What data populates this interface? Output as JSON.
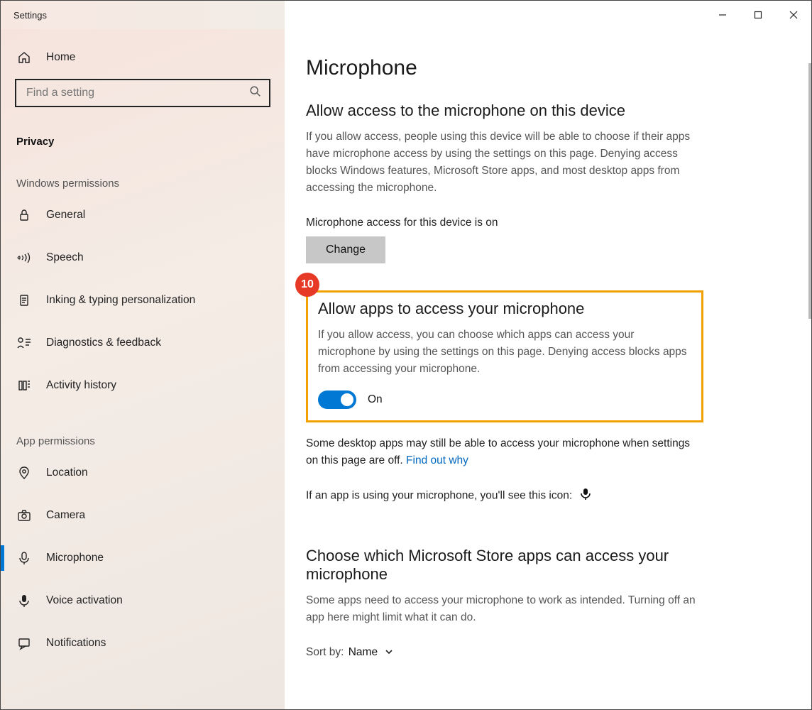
{
  "window": {
    "title": "Settings"
  },
  "sidebar": {
    "home_label": "Home",
    "search_placeholder": "Find a setting",
    "category": "Privacy",
    "group_windows": "Windows permissions",
    "group_app": "App permissions",
    "items_windows": [
      {
        "id": "general",
        "label": "General",
        "icon": "lock"
      },
      {
        "id": "speech",
        "label": "Speech",
        "icon": "speech"
      },
      {
        "id": "inking",
        "label": "Inking & typing personalization",
        "icon": "clipboard"
      },
      {
        "id": "diag",
        "label": "Diagnostics & feedback",
        "icon": "feedback"
      },
      {
        "id": "activity",
        "label": "Activity history",
        "icon": "history"
      }
    ],
    "items_app": [
      {
        "id": "location",
        "label": "Location",
        "icon": "location"
      },
      {
        "id": "camera",
        "label": "Camera",
        "icon": "camera"
      },
      {
        "id": "microphone",
        "label": "Microphone",
        "icon": "mic",
        "selected": true
      },
      {
        "id": "voice",
        "label": "Voice activation",
        "icon": "voice"
      },
      {
        "id": "notifications",
        "label": "Notifications",
        "icon": "bell"
      }
    ]
  },
  "main": {
    "title": "Microphone",
    "s1_title": "Allow access to the microphone on this device",
    "s1_desc": "If you allow access, people using this device will be able to choose if their apps have microphone access by using the settings on this page. Denying access blocks Windows features, Microsoft Store apps, and most desktop apps from accessing the microphone.",
    "s1_status": "Microphone access for this device is on",
    "change_btn": "Change",
    "badge": "10",
    "s2_title": "Allow apps to access your microphone",
    "s2_desc": "If you allow access, you can choose which apps can access your microphone by using the settings on this page. Denying access blocks apps from accessing your microphone.",
    "toggle_label": "On",
    "s2_note_a": "Some desktop apps may still be able to access your microphone when settings on this page are off. ",
    "s2_link": "Find out why",
    "s2_icon_line": "If an app is using your microphone, you'll see this icon:",
    "s3_title": "Choose which Microsoft Store apps can access your microphone",
    "s3_desc": "Some apps need to access your microphone to work as intended. Turning off an app here might limit what it can do.",
    "sort_prefix": "Sort by:",
    "sort_value": "Name"
  }
}
